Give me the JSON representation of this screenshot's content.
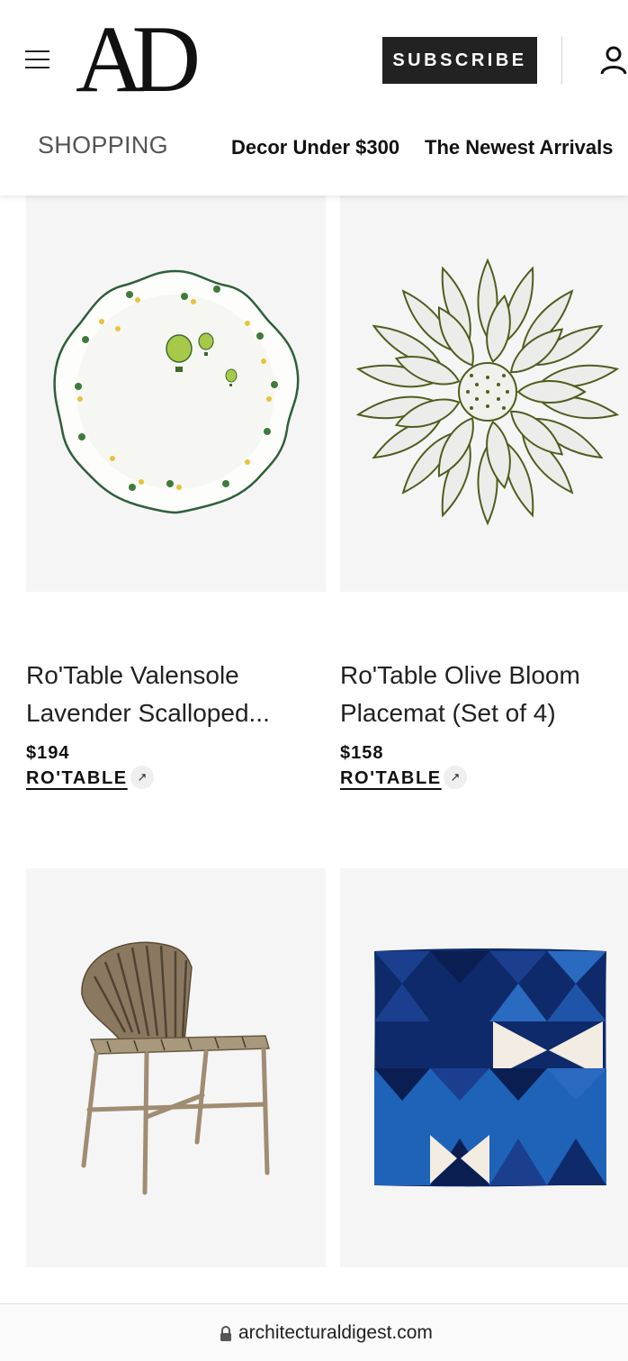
{
  "header": {
    "logo": "AD",
    "subscribe_label": "SUBSCRIBE",
    "section_label": "SHOPPING",
    "nav": [
      "Decor Under $300",
      "The Newest Arrivals"
    ]
  },
  "products": [
    {
      "title_line1": "Ro'Table Valensole",
      "title_line2": "Lavender Scalloped...",
      "price": "$194",
      "retailer": "RO'TABLE",
      "image": "scalloped-plate-with-hot-air-balloons"
    },
    {
      "title_line1": "Ro'Table Olive Bloom",
      "title_line2": "Placemat (Set of 4)",
      "price": "$158",
      "retailer": "RO'TABLE",
      "image": "sunflower-placemat"
    },
    {
      "image": "rattan-dining-chair"
    },
    {
      "image": "blue-patchwork-pillow"
    }
  ],
  "browser": {
    "url": "architecturaldigest.com"
  },
  "icons": {
    "menu": "hamburger-icon",
    "account": "user-icon",
    "external": "arrow-up-right-icon",
    "lock": "lock-icon"
  }
}
